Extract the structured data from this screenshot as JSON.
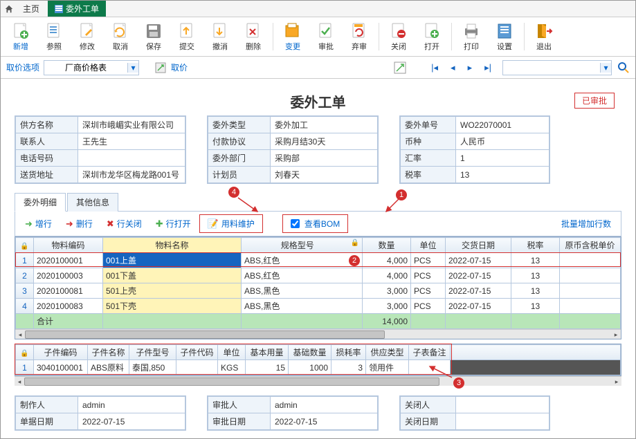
{
  "tabs": {
    "home": "主页",
    "active": "委外工单"
  },
  "toolbar": {
    "new": "新增",
    "ref": "参照",
    "modify": "修改",
    "cancel": "取消",
    "save": "保存",
    "submit": "提交",
    "undo": "撤消",
    "delete": "删除",
    "change": "变更",
    "approve": "审批",
    "reject": "弃审",
    "close": "关闭",
    "open": "打开",
    "print": "打印",
    "settings": "设置",
    "exit": "退出"
  },
  "filter": {
    "price_option": "取价选项",
    "vendor_price": "厂商价格表",
    "fetch_price": "取价"
  },
  "page_title": "委外工单",
  "status": "已审批",
  "panel1": {
    "supplier_lbl": "供方名称",
    "supplier": "深圳市峨嵋实业有限公司",
    "contact_lbl": "联系人",
    "contact": "王先生",
    "phone_lbl": "电话号码",
    "phone": "",
    "addr_lbl": "送货地址",
    "addr": "深圳市龙华区梅龙路001号"
  },
  "panel2": {
    "type_lbl": "委外类型",
    "type": "委外加工",
    "pay_lbl": "付款协议",
    "pay": "采购月结30天",
    "dept_lbl": "委外部门",
    "dept": "采购部",
    "planner_lbl": "计划员",
    "planner": "刘春天"
  },
  "panel3": {
    "no_lbl": "委外单号",
    "no": "WO22070001",
    "curr_lbl": "币种",
    "curr": "人民币",
    "rate_lbl": "汇率",
    "rate": "1",
    "tax_lbl": "税率",
    "tax": "13"
  },
  "inner_tabs": {
    "detail": "委外明细",
    "other": "其他信息"
  },
  "grid_tb": {
    "add_row": "增行",
    "del_row": "删行",
    "close_row": "行关闭",
    "open_row": "行打开",
    "material": "用料维护",
    "view_bom": "查看BOM",
    "batch_add": "批量增加行数"
  },
  "grid_headers": {
    "code": "物料编码",
    "name": "物料名称",
    "spec": "规格型号",
    "qty": "数量",
    "unit": "单位",
    "deliv": "交货日期",
    "taxrate": "税率",
    "price": "原币含税单价"
  },
  "grid_rows": [
    {
      "n": "1",
      "code": "2020100001",
      "name": "001上盖",
      "spec": "ABS,红色",
      "qty": "4,000",
      "unit": "PCS",
      "deliv": "2022-07-15",
      "tax": "13",
      "price": ""
    },
    {
      "n": "2",
      "code": "2020100003",
      "name": "001下盖",
      "spec": "ABS,红色",
      "qty": "4,000",
      "unit": "PCS",
      "deliv": "2022-07-15",
      "tax": "13",
      "price": ""
    },
    {
      "n": "3",
      "code": "2020100081",
      "name": "501上壳",
      "spec": "ABS,黑色",
      "qty": "3,000",
      "unit": "PCS",
      "deliv": "2022-07-15",
      "tax": "13",
      "price": ""
    },
    {
      "n": "4",
      "code": "2020100083",
      "name": "501下壳",
      "spec": "ABS,黑色",
      "qty": "3,000",
      "unit": "PCS",
      "deliv": "2022-07-15",
      "tax": "13",
      "price": ""
    }
  ],
  "grid_total": {
    "label": "合计",
    "qty": "14,000"
  },
  "sub_headers": {
    "code": "子件编码",
    "name": "子件名称",
    "model": "子件型号",
    "itemcode": "子件代码",
    "unit": "单位",
    "base": "基本用量",
    "baseqty": "基础数量",
    "loss": "损耗率",
    "supply": "供应类型",
    "remark": "子表备注"
  },
  "sub_rows": [
    {
      "n": "1",
      "code": "3040100001",
      "name": "ABS原料",
      "model": "泰国,850",
      "itemcode": "",
      "unit": "KGS",
      "base": "15",
      "baseqty": "1000",
      "loss": "3",
      "supply": "领用件",
      "remark": ""
    }
  ],
  "footer": {
    "maker_lbl": "制作人",
    "maker": "admin",
    "doc_date_lbl": "单据日期",
    "doc_date": "2022-07-15",
    "approver_lbl": "审批人",
    "approver": "admin",
    "appr_date_lbl": "审批日期",
    "appr_date": "2022-07-15",
    "closer_lbl": "关闭人",
    "closer": "",
    "close_date_lbl": "关闭日期",
    "close_date": ""
  },
  "callouts": {
    "c1": "1",
    "c2": "2",
    "c3": "3",
    "c4": "4"
  }
}
